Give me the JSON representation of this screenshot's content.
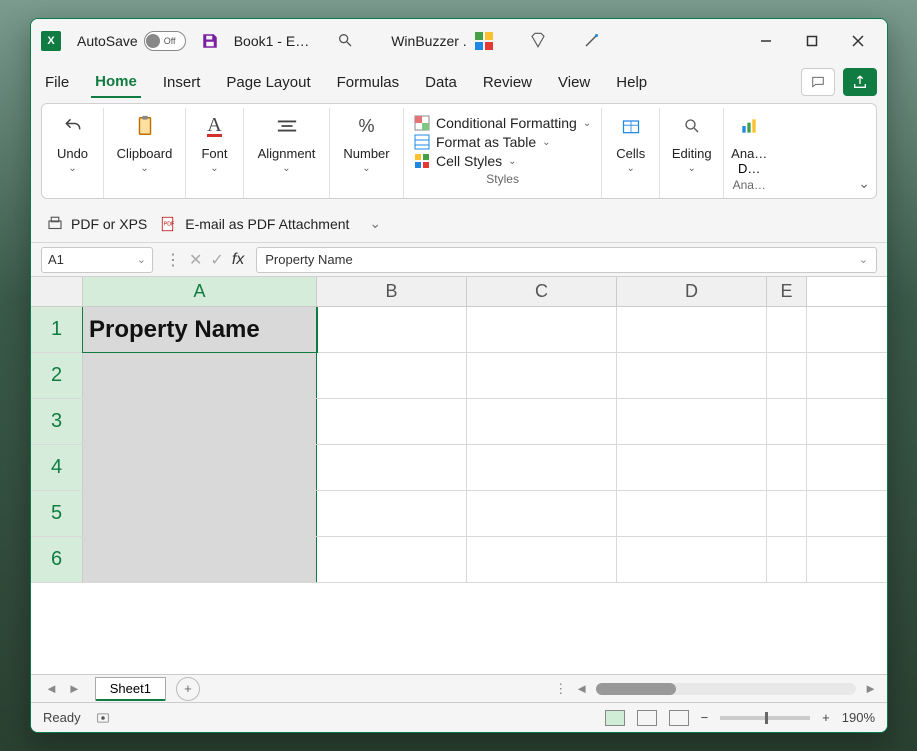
{
  "title": {
    "autosave_label": "AutoSave",
    "autosave_state": "Off",
    "doc_name": "Book1  -  E…",
    "brand": "WinBuzzer ."
  },
  "tabs": {
    "file": "File",
    "home": "Home",
    "insert": "Insert",
    "page_layout": "Page Layout",
    "formulas": "Formulas",
    "data": "Data",
    "review": "Review",
    "view": "View",
    "help": "Help"
  },
  "ribbon": {
    "undo": "Undo",
    "clipboard": "Clipboard",
    "font": "Font",
    "alignment": "Alignment",
    "number": "Number",
    "cond_fmt": "Conditional Formatting",
    "fmt_table": "Format as Table",
    "cell_styles": "Cell Styles",
    "styles_caption": "Styles",
    "cells": "Cells",
    "editing": "Editing",
    "analyze": "Ana…",
    "analyze2": "D…",
    "analyze_caption": "Ana…"
  },
  "subbar": {
    "pdf": "PDF or XPS",
    "email_pdf": "E-mail as PDF Attachment"
  },
  "fxbar": {
    "namebox": "A1",
    "formula": "Property Name"
  },
  "grid": {
    "cols": [
      "A",
      "B",
      "C",
      "D",
      "E"
    ],
    "rows": [
      "1",
      "2",
      "3",
      "4",
      "5",
      "6"
    ],
    "a1": "Property Name"
  },
  "sheetbar": {
    "sheet": "Sheet1"
  },
  "status": {
    "ready": "Ready",
    "zoom": "190%"
  }
}
